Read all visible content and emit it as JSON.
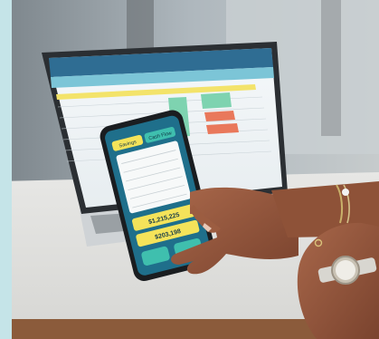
{
  "scene": {
    "description_free": true,
    "accent_colors": {
      "left_strip": "#c5e4e8",
      "laptop_header": "#2f6d93",
      "laptop_green": "#7ed3b0",
      "laptop_red": "#e9785b",
      "laptop_yellow": "#f3e36a",
      "phone_screen": "#1f6f8b",
      "phone_yellow": "#f4e35a",
      "phone_teal": "#3fbfae"
    }
  },
  "phone": {
    "tab_left": "Savings",
    "tab_right": "Cash Flow",
    "amount_top": "$1,215,225",
    "amount_bottom": "$203,198"
  }
}
